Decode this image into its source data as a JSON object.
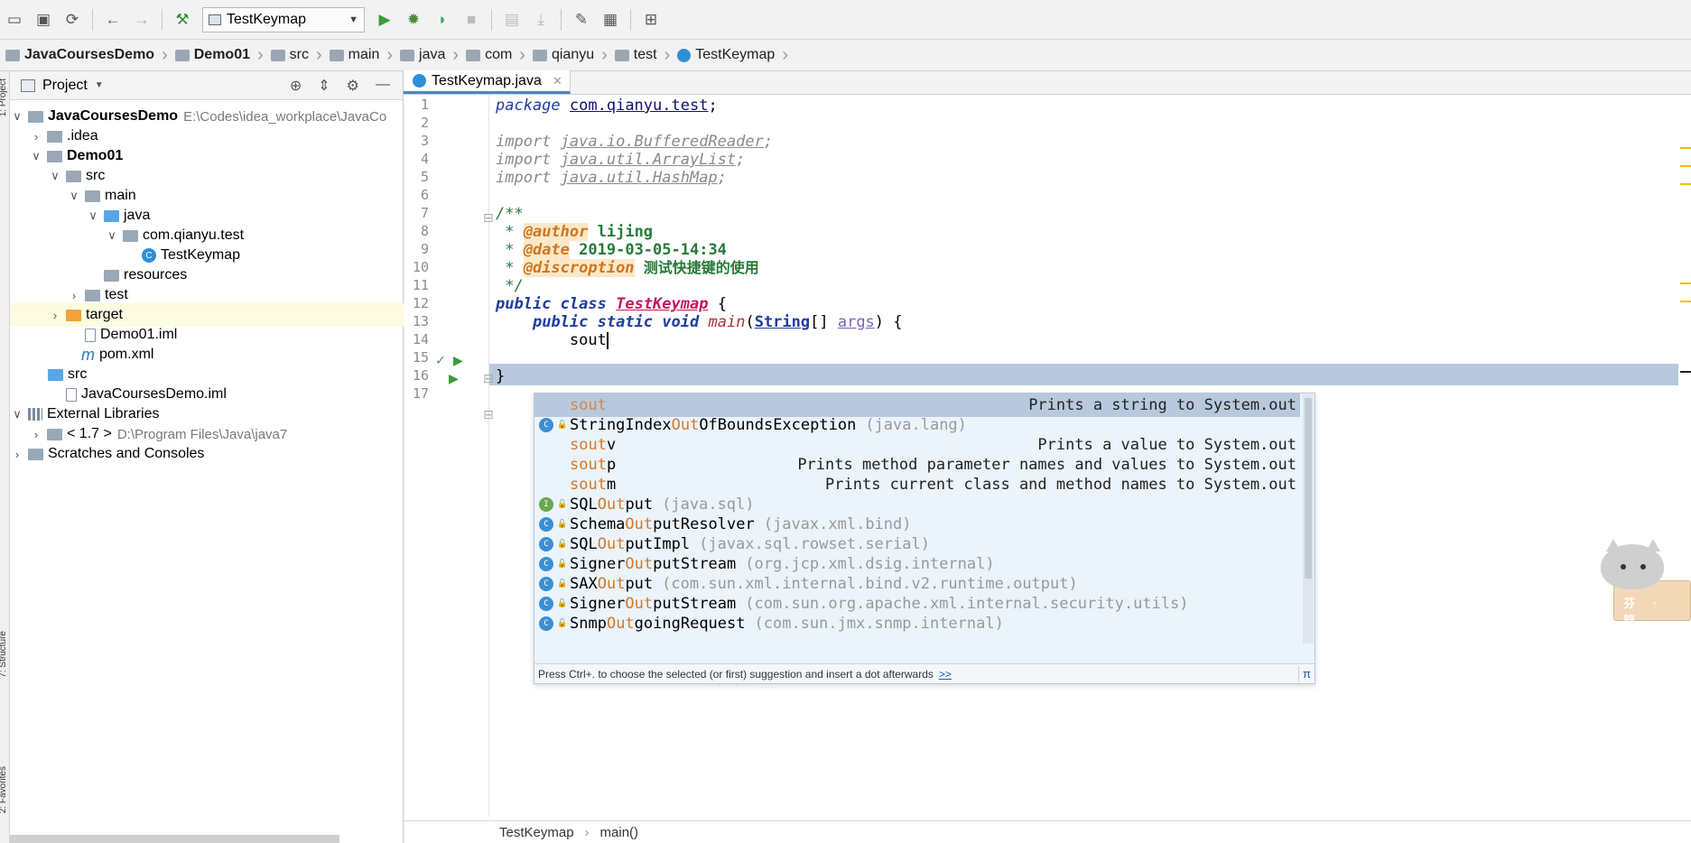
{
  "toolbar": {
    "run_config": "TestKeymap"
  },
  "breadcrumbs": [
    {
      "label": "JavaCoursesDemo",
      "bold": true
    },
    {
      "label": "Demo01",
      "bold": true
    },
    {
      "label": "src",
      "bold": false
    },
    {
      "label": "main",
      "bold": false
    },
    {
      "label": "java",
      "bold": false
    },
    {
      "label": "com",
      "bold": false
    },
    {
      "label": "qianyu",
      "bold": false
    },
    {
      "label": "test",
      "bold": false
    },
    {
      "label": "TestKeymap",
      "bold": false
    }
  ],
  "left_strip": {
    "project": "1: Project",
    "structure": "7: Structure",
    "favorites": "2: Favorites"
  },
  "project_panel": {
    "title": "Project",
    "tree": [
      {
        "label": "JavaCoursesDemo",
        "path": "E:\\Codes\\idea_workplace\\JavaCo",
        "bold": true
      },
      {
        "label": ".idea"
      },
      {
        "label": "Demo01",
        "bold": true
      },
      {
        "label": "src"
      },
      {
        "label": "main"
      },
      {
        "label": "java"
      },
      {
        "label": "com.qianyu.test"
      },
      {
        "label": "TestKeymap"
      },
      {
        "label": "resources"
      },
      {
        "label": "test"
      },
      {
        "label": "target"
      },
      {
        "label": "Demo01.iml"
      },
      {
        "label": "pom.xml"
      },
      {
        "label": "src"
      },
      {
        "label": "JavaCoursesDemo.iml"
      },
      {
        "label": "External Libraries"
      },
      {
        "label": "< 1.7 >",
        "path": "D:\\Program Files\\Java\\java7"
      },
      {
        "label": "Scratches and Consoles"
      }
    ]
  },
  "editor": {
    "tab": "TestKeymap.java",
    "line_numbers": [
      "1",
      "2",
      "3",
      "4",
      "5",
      "6",
      "7",
      "8",
      "9",
      "10",
      "11",
      "12",
      "13",
      "14",
      "15",
      "16",
      "17"
    ],
    "code": {
      "pkg_kw": "package",
      "pkg_name": "com.qianyu.test",
      "import_kw": "import",
      "imp1": "java.io.BufferedReader",
      "imp2": "java.util.ArrayList",
      "imp3": "java.util.HashMap",
      "doc_open": "/**",
      "author_tag": "@author",
      "author_val": "lijing",
      "date_tag": "@date",
      "date_val": "2019-03-05-14:34",
      "desc_tag": "@discroption",
      "desc_val": "测试快捷键的使用",
      "doc_close": " */",
      "kw_public": "public",
      "kw_class": "class",
      "class_name": "TestKeymap",
      "kw_static": "static",
      "kw_void": "void",
      "method_name": "main",
      "param_type": "String",
      "param_name": "args",
      "typed": "sout"
    }
  },
  "completion": {
    "items": [
      {
        "pre": "",
        "match": "sout",
        "post": "",
        "pkg": "",
        "desc": "Prints a string to System.out",
        "icon": "none",
        "selected": true
      },
      {
        "pre": "StringIndex",
        "match": "Out",
        "post": "OfBoundsException",
        "pkg": "(java.lang)",
        "desc": "",
        "icon": "class"
      },
      {
        "pre": "",
        "match": "sout",
        "post": "v",
        "pkg": "",
        "desc": "Prints a value to System.out",
        "icon": "none"
      },
      {
        "pre": "",
        "match": "sout",
        "post": "p",
        "pkg": "",
        "desc": "Prints method parameter names and values to System.out",
        "icon": "none"
      },
      {
        "pre": "",
        "match": "sout",
        "post": "m",
        "pkg": "",
        "desc": "Prints current class and method names to System.out",
        "icon": "none"
      },
      {
        "pre": "SQL",
        "match": "Out",
        "post": "put",
        "pkg": "(java.sql)",
        "desc": "",
        "icon": "interface"
      },
      {
        "pre": "Schema",
        "match": "Out",
        "post": "putResolver",
        "pkg": "(javax.xml.bind)",
        "desc": "",
        "icon": "class"
      },
      {
        "pre": "SQL",
        "match": "Out",
        "post": "putImpl",
        "pkg": "(javax.sql.rowset.serial)",
        "desc": "",
        "icon": "class"
      },
      {
        "pre": "Signer",
        "match": "Out",
        "post": "putStream",
        "pkg": "(org.jcp.xml.dsig.internal)",
        "desc": "",
        "icon": "class"
      },
      {
        "pre": "SAX",
        "match": "Out",
        "post": "put",
        "pkg": "(com.sun.xml.internal.bind.v2.runtime.output)",
        "desc": "",
        "icon": "class"
      },
      {
        "pre": "Signer",
        "match": "Out",
        "post": "putStream",
        "pkg": "(com.sun.org.apache.xml.internal.security.utils)",
        "desc": "",
        "icon": "class"
      },
      {
        "pre": "Snmp",
        "match": "Out",
        "post": "goingRequest",
        "pkg": "(com.sun.jmx.snmp.internal)",
        "desc": "",
        "icon": "class"
      }
    ],
    "footer": "Press Ctrl+. to choose the selected (or first) suggestion and insert a dot afterwards",
    "footer_link": ">>",
    "pi": "π"
  },
  "statusbar": {
    "class": "TestKeymap",
    "method": "main()"
  },
  "mascot_text": "芬 · 管"
}
